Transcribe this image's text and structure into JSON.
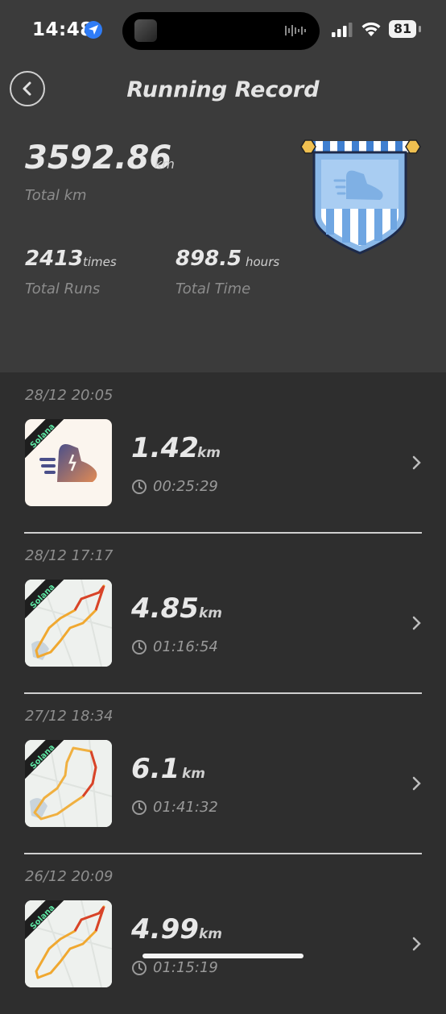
{
  "status_bar": {
    "time": "14:48",
    "battery": "81"
  },
  "header": {
    "title": "Running Record",
    "total_km": {
      "value": "3592.86",
      "unit": "km",
      "label": "Total km"
    },
    "total_runs": {
      "value": "2413",
      "unit": "times",
      "label": "Total Runs"
    },
    "total_time": {
      "value": "898.5",
      "unit": "hours",
      "label": "Total Time"
    }
  },
  "records": [
    {
      "date": "28/12 20:05",
      "km": "1.42",
      "unit": "km",
      "duration": "00:25:29",
      "tag": "Solana",
      "thumbnail": "shoe-logo"
    },
    {
      "date": "28/12 17:17",
      "km": "4.85",
      "unit": "km",
      "duration": "01:16:54",
      "tag": "Solana",
      "thumbnail": "route-map"
    },
    {
      "date": "27/12 18:34",
      "km": "6.1",
      "unit": "km",
      "duration": "01:41:32",
      "tag": "Solana",
      "thumbnail": "route-map"
    },
    {
      "date": "26/12 20:09",
      "km": "4.99",
      "unit": "km",
      "duration": "01:15:19",
      "tag": "Solana",
      "thumbnail": "route-map"
    }
  ],
  "colors": {
    "header_bg": "#3b3b3b",
    "list_bg": "#2e2e2e",
    "accent_route": "#e8a73a",
    "badge_blue": "#8ab8e8"
  }
}
